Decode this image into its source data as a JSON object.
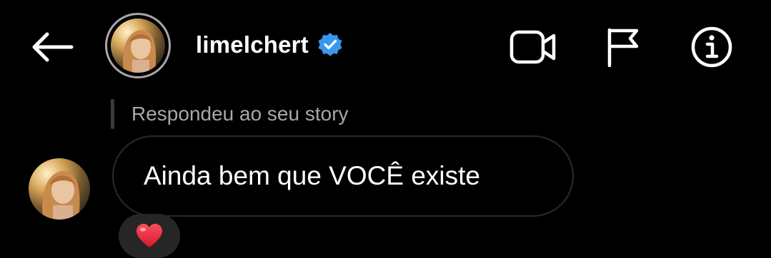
{
  "header": {
    "username": "limelchert",
    "verified": true,
    "icons": {
      "back": "arrow-left-icon",
      "video": "video-call-icon",
      "flag": "flag-icon",
      "info": "info-icon",
      "verified": "verified-badge-icon"
    }
  },
  "thread": {
    "reply_context": "Respondeu ao seu story",
    "message_text": "Ainda bem que VOCÊ existe",
    "reaction": "heart-emoji"
  },
  "colors": {
    "background": "#000000",
    "text": "#ffffff",
    "muted_text": "#a8a8a8",
    "verified_blue": "#3897f0",
    "bubble_border": "#2a2a2a",
    "reaction_bg": "#262626",
    "heart_red": "#e0243a"
  }
}
